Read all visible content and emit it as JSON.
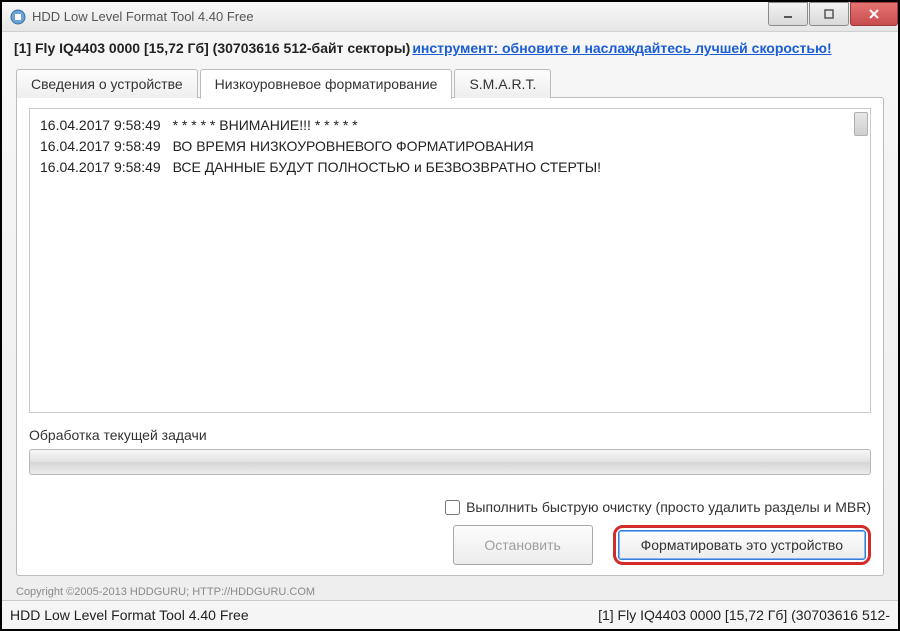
{
  "titlebar": {
    "title": "HDD Low Level Format Tool 4.40    Free"
  },
  "infobar": {
    "device": "[1]  Fly IQ4403   0000   [15,72 Гб]   (30703616 512-байт секторы)",
    "upgrade_link": "инструмент: обновите и наслаждайтесь лучшей скоростью!"
  },
  "tabs": {
    "device_info": "Сведения о устройстве",
    "low_level": "Низкоуровневое форматирование",
    "smart": "S.M.A.R.T."
  },
  "log": [
    {
      "ts": "16.04.2017 9:58:49",
      "msg": "* * * * * ВНИМАНИЕ!!! * * * * *"
    },
    {
      "ts": "16.04.2017 9:58:49",
      "msg": "ВО ВРЕМЯ НИЗКОУРОВНЕВОГО ФОРМАТИРОВАНИЯ"
    },
    {
      "ts": "16.04.2017 9:58:49",
      "msg": "ВСЕ ДАННЫЕ БУДУТ ПОЛНОСТЬЮ и БЕЗВОЗВРАТНО СТЕРТЫ!"
    }
  ],
  "progress": {
    "label": "Обработка текущей задачи"
  },
  "checkbox": {
    "label": "Выполнить быструю очистку (просто удалить разделы и MBR)",
    "checked": false
  },
  "buttons": {
    "stop": "Остановить",
    "format": "Форматировать это устройство"
  },
  "copyright": "Copyright ©2005-2013 HDDGURU;   HTTP://HDDGURU.COM",
  "statusbar": {
    "left": "HDD Low Level Format Tool 4.40    Free",
    "right": "[1]  Fly IQ4403   0000   [15,72 Гб]   (30703616 512-"
  }
}
